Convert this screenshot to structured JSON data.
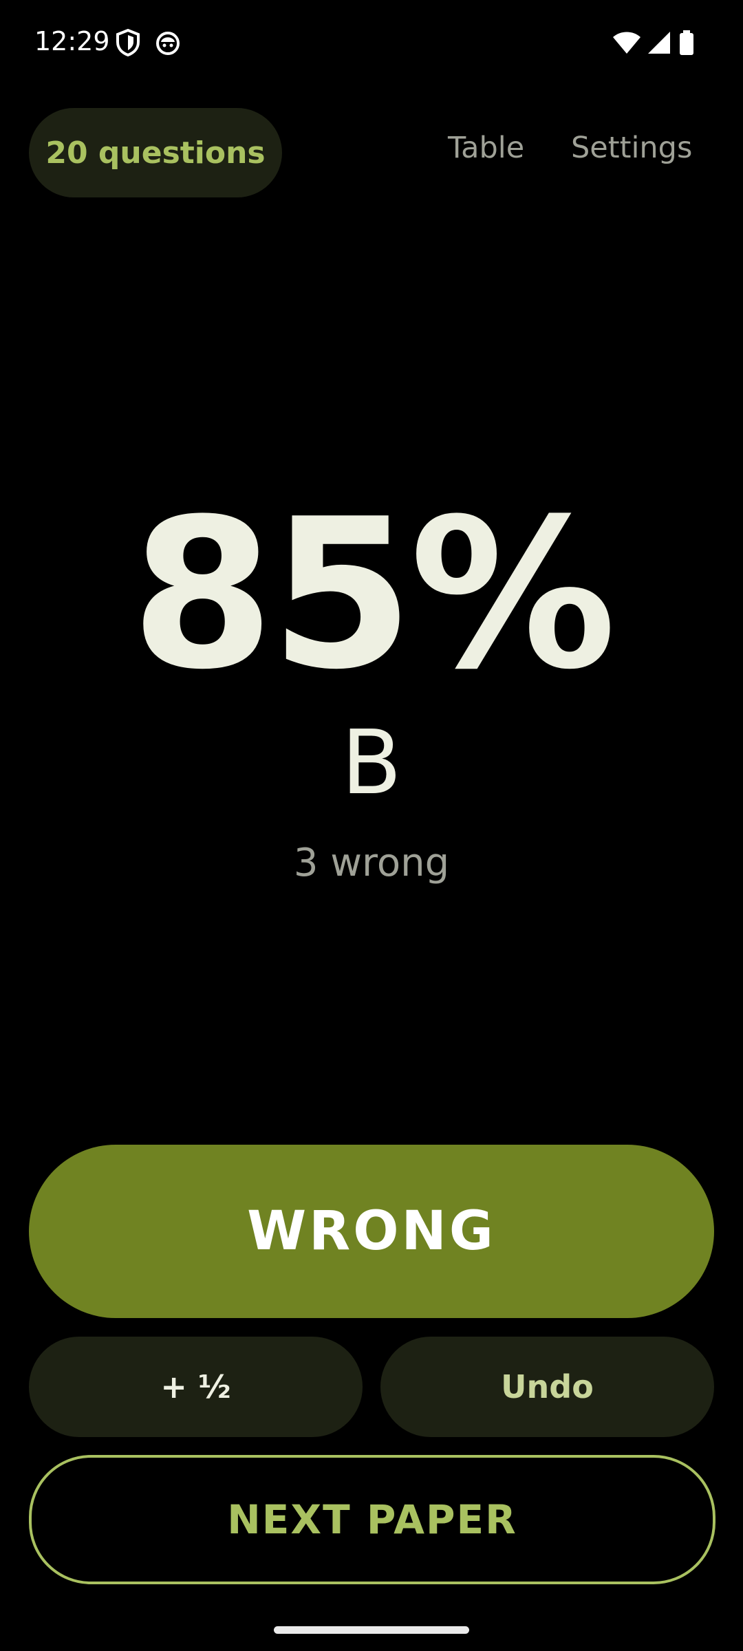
{
  "status_bar": {
    "time": "12:29",
    "icons": [
      "shield-icon",
      "face-icon",
      "wifi-icon",
      "signal-icon",
      "battery-icon"
    ]
  },
  "header": {
    "questions_pill": "20 questions",
    "table_link": "Table",
    "settings_link": "Settings"
  },
  "result": {
    "score": "85%",
    "grade": "B",
    "wrong_count": "3 wrong"
  },
  "actions": {
    "wrong_label": "WRONG",
    "half_label": "+ ½",
    "undo_label": "Undo",
    "next_label": "NEXT PAPER"
  },
  "colors": {
    "background": "#000000",
    "accent": "#a9c160",
    "wrong_button": "#708322",
    "pill_bg": "#1d2113",
    "text_primary": "#eef0e2",
    "text_muted": "#9fa197"
  }
}
